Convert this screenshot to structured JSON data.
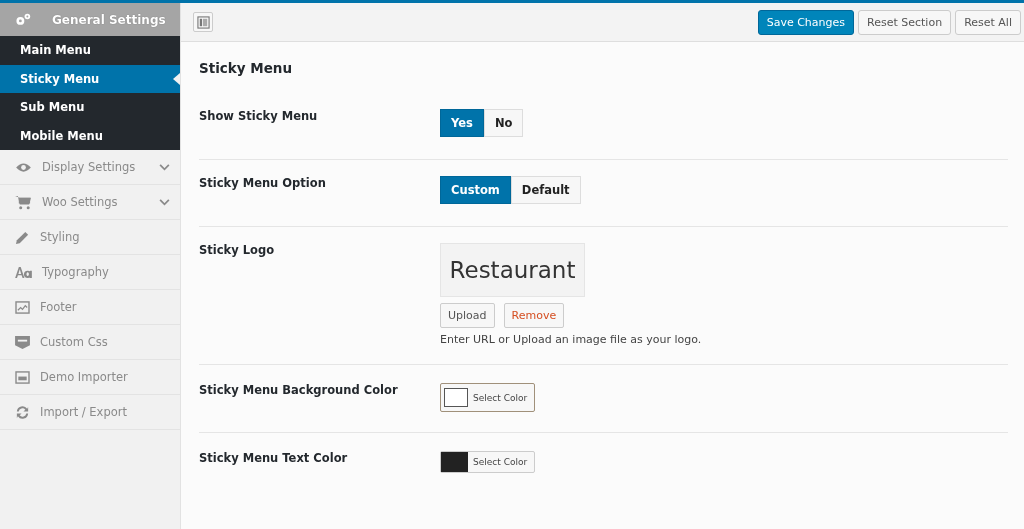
{
  "sidebar": {
    "items": [
      {
        "label": "General Settings",
        "expanded": true,
        "children": [
          {
            "label": "Main Menu",
            "selected": false
          },
          {
            "label": "Sticky Menu",
            "selected": true
          },
          {
            "label": "Sub Menu",
            "selected": false
          },
          {
            "label": "Mobile Menu",
            "selected": false
          }
        ]
      },
      {
        "label": "Display Settings",
        "expanded": false
      },
      {
        "label": "Woo Settings",
        "expanded": false
      },
      {
        "label": "Styling"
      },
      {
        "label": "Typography"
      },
      {
        "label": "Footer"
      },
      {
        "label": "Custom Css"
      },
      {
        "label": "Demo Importer"
      },
      {
        "label": "Import / Export"
      }
    ]
  },
  "toolbar": {
    "buttons": [
      {
        "label": "Save Changes",
        "kind": "primary"
      },
      {
        "label": "Reset Section",
        "kind": "default"
      },
      {
        "label": "Reset All",
        "kind": "default"
      }
    ]
  },
  "section": {
    "title": "Sticky Menu",
    "fields": [
      {
        "kind": "toggle",
        "label": "Show Sticky Menu",
        "options": [
          {
            "label": "Yes",
            "selected": true
          },
          {
            "label": "No",
            "selected": false
          }
        ]
      },
      {
        "kind": "toggle",
        "label": "Sticky Menu Option",
        "options": [
          {
            "label": "Custom",
            "selected": true
          },
          {
            "label": "Default",
            "selected": false
          }
        ]
      },
      {
        "kind": "image",
        "label": "Sticky Logo",
        "preview": "Restaurant",
        "upload": "Upload",
        "remove": "Remove",
        "help": "Enter URL or Upload an image file as your logo."
      },
      {
        "kind": "color",
        "label": "Sticky Menu Background Color",
        "color": "#ffffff",
        "button": "Select Color",
        "focused": true
      },
      {
        "kind": "color",
        "label": "Sticky Menu Text Color",
        "color": "#222222",
        "button": "Select Color",
        "focused": false
      }
    ]
  }
}
